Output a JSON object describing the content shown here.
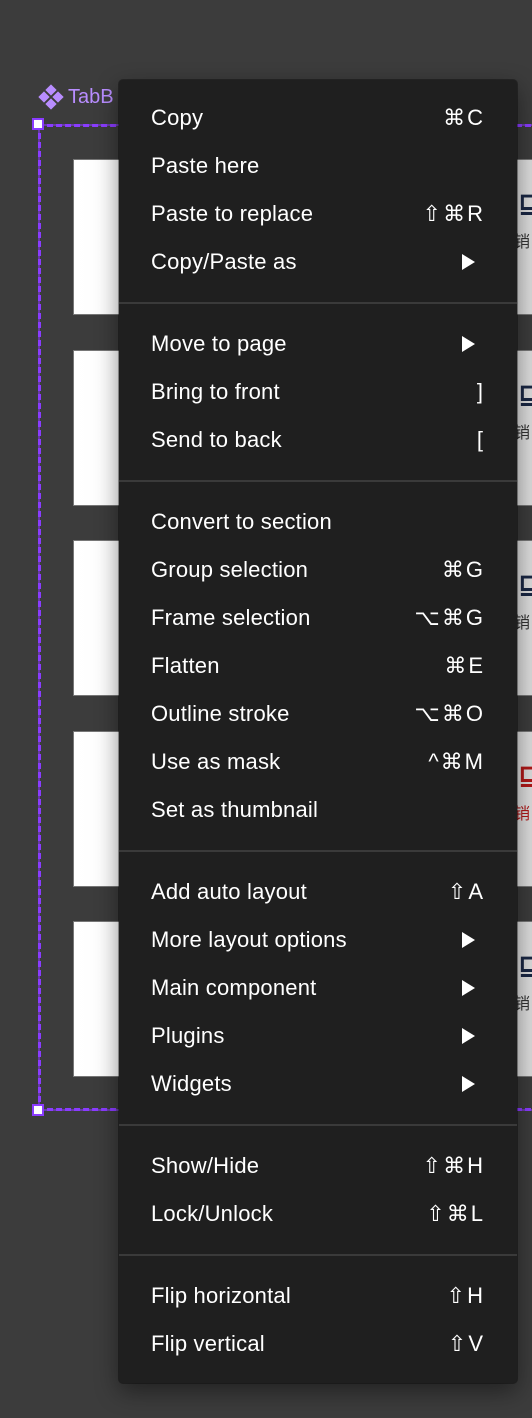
{
  "canvas": {
    "frame_label": "TabB",
    "frame_icon": "component-icon",
    "accent_color": "#8a3cff",
    "label_color": "#b88dff",
    "cards": [
      {
        "cart_glyph": "⊑",
        "text": "销",
        "variant": "default"
      },
      {
        "cart_glyph": "⊑",
        "text": "销",
        "variant": "default"
      },
      {
        "cart_glyph": "⊑",
        "text": "销",
        "variant": "default"
      },
      {
        "cart_glyph": "⊑",
        "text": "销",
        "variant": "active"
      },
      {
        "cart_glyph": "⊑",
        "text": "销",
        "variant": "default"
      }
    ]
  },
  "menu": {
    "groups": [
      [
        {
          "label": "Copy",
          "shortcut": "⌘C"
        },
        {
          "label": "Paste here",
          "shortcut": ""
        },
        {
          "label": "Paste to replace",
          "shortcut": "⇧⌘R"
        },
        {
          "label": "Copy/Paste as",
          "submenu": true
        }
      ],
      [
        {
          "label": "Move to page",
          "submenu": true
        },
        {
          "label": "Bring to front",
          "shortcut": "]"
        },
        {
          "label": "Send to back",
          "shortcut": "["
        }
      ],
      [
        {
          "label": "Convert to section",
          "shortcut": ""
        },
        {
          "label": "Group selection",
          "shortcut": "⌘G"
        },
        {
          "label": "Frame selection",
          "shortcut": "⌥⌘G"
        },
        {
          "label": "Flatten",
          "shortcut": "⌘E"
        },
        {
          "label": "Outline stroke",
          "shortcut": "⌥⌘O"
        },
        {
          "label": "Use as mask",
          "shortcut": "^⌘M"
        },
        {
          "label": "Set as thumbnail",
          "shortcut": ""
        }
      ],
      [
        {
          "label": "Add auto layout",
          "shortcut": "⇧A"
        },
        {
          "label": "More layout options",
          "submenu": true
        },
        {
          "label": "Main component",
          "submenu": true
        },
        {
          "label": "Plugins",
          "submenu": true
        },
        {
          "label": "Widgets",
          "submenu": true
        }
      ],
      [
        {
          "label": "Show/Hide",
          "shortcut": "⇧⌘H"
        },
        {
          "label": "Lock/Unlock",
          "shortcut": "⇧⌘L"
        }
      ],
      [
        {
          "label": "Flip horizontal",
          "shortcut": "⇧H"
        },
        {
          "label": "Flip vertical",
          "shortcut": "⇧V"
        }
      ]
    ]
  }
}
